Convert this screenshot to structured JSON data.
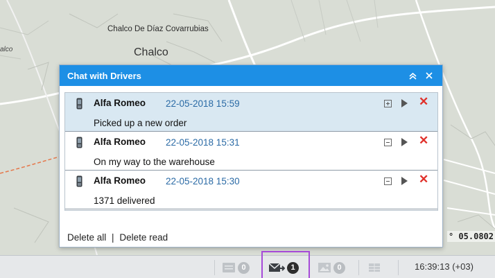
{
  "map": {
    "labels": {
      "town_full": "Chalco De Díaz Covarrubias",
      "town": "Chalco",
      "edge_label": "alco"
    },
    "coordinate_readout": "° 05.0802"
  },
  "chat": {
    "title": "Chat with Drivers",
    "header_icons": [
      "collapse-icon",
      "close-icon"
    ],
    "messages": [
      {
        "sender": "Alfa Romeo",
        "time": "22-05-2018 15:59",
        "text": "Picked up a new order",
        "selected": true,
        "expand_state": "plus"
      },
      {
        "sender": "Alfa Romeo",
        "time": "22-05-2018 15:31",
        "text": "On my way to the warehouse",
        "selected": false,
        "expand_state": "minus"
      },
      {
        "sender": "Alfa Romeo",
        "time": "22-05-2018 15:30",
        "text": "1371 delivered",
        "selected": false,
        "expand_state": "minus"
      }
    ],
    "footer": {
      "delete_all": "Delete all",
      "separator": "|",
      "delete_read": "Delete read"
    }
  },
  "statusbar": {
    "items": [
      {
        "icon": "message-icon",
        "count": "0"
      },
      {
        "icon": "mail-icon",
        "count": "1"
      },
      {
        "icon": "image-icon",
        "count": "0"
      },
      {
        "icon": "table-icon"
      }
    ],
    "clock": "16:39:13 (+03)"
  },
  "colors": {
    "header_blue": "#1d8fe5",
    "time_blue": "#2a6aa5",
    "delete_red": "#e0302a",
    "selected_row": "#d9e8f2",
    "highlight_purple": "#a64ad8"
  }
}
